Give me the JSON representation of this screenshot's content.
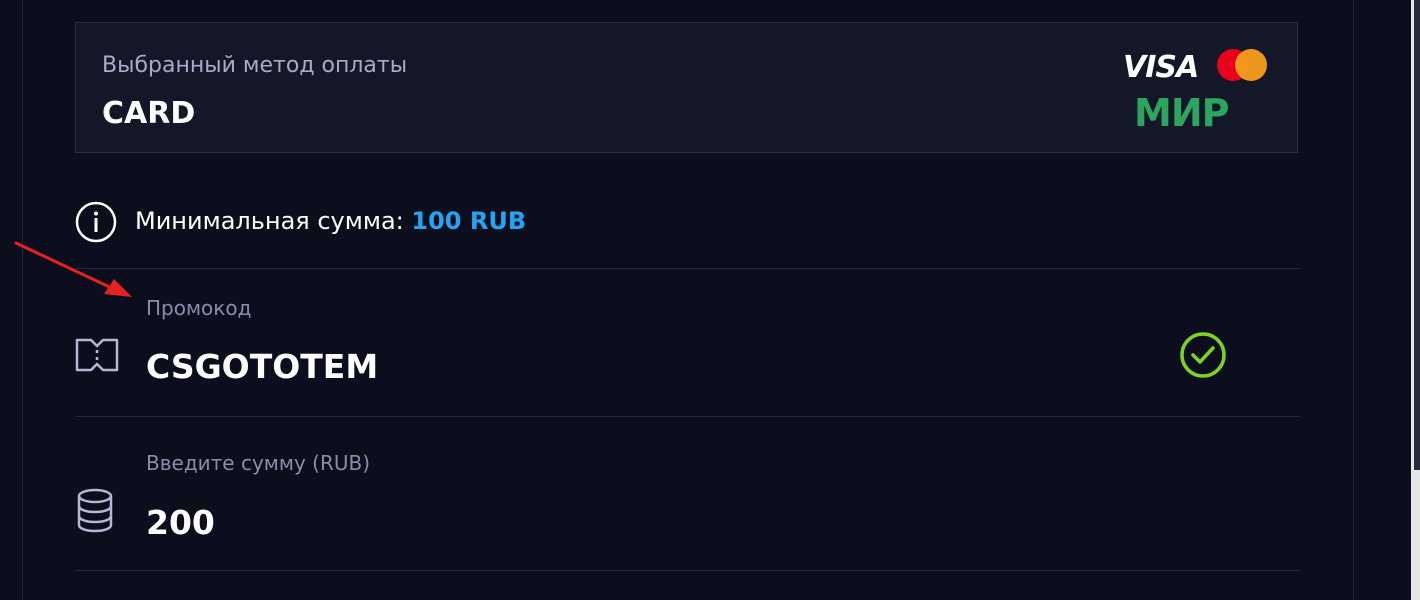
{
  "payment_method": {
    "label": "Выбранный метод оплаты",
    "value": "CARD",
    "logos": [
      "VISA",
      "mastercard",
      "МИР"
    ],
    "visa_text": "VISA",
    "mir_text": "МИР"
  },
  "minimum": {
    "label": "Минимальная сумма:",
    "value": "100 RUB",
    "value_color": "#1fa7f5"
  },
  "promo": {
    "label": "Промокод",
    "value": "CSGOTOTEM",
    "icon": "ticket-icon",
    "status_icon": "check-circle-icon",
    "status_color": "#7ed321"
  },
  "amount": {
    "label": "Введите сумму (RUB)",
    "value": "200",
    "icon": "coins-stack-icon"
  },
  "annotation": {
    "arrow_color": "#e52222"
  }
}
